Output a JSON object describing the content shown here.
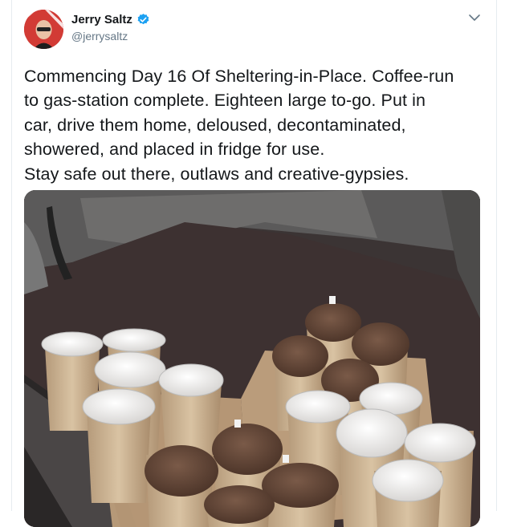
{
  "author": {
    "name": "Jerry Saltz",
    "handle": "@jerrysaltz",
    "verified": true
  },
  "tweet": {
    "lines": [
      "Commencing Day 16 Of Sheltering-in-Place. Coffee-run",
      "to gas-station complete. Eighteen large to-go.  Put in",
      "car, drive them home, deloused, decontaminated,",
      "showered, and placed in fridge for use.",
      "Stay safe out there, outlaws and creative-gypsies."
    ]
  },
  "icons": {
    "verified": "verified-badge-icon",
    "menu": "chevron-down-icon"
  },
  "colors": {
    "verified_blue": "#1da1f2",
    "secondary_text": "#657786",
    "primary_text": "#14171a",
    "border": "#e6ecf0"
  }
}
